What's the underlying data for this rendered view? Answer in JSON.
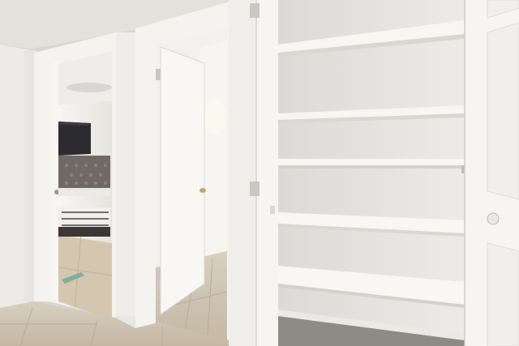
{
  "scene": {
    "kind": "real-estate interior photo",
    "visible_text": []
  },
  "palette": {
    "wall": "#ecebe8",
    "ceiling": "#e6e4e0",
    "trim": "#f4f3f0",
    "floor_tile": "#d6cbb8",
    "floor_dark": "#b7ac98",
    "shelf": "#f5f4f1",
    "shadow": "#c9c7c2",
    "headboard": "#6f6a66",
    "tv": "#2c2c30",
    "door_knob": "#c7a35b"
  },
  "items": [
    {
      "name": "left-wall"
    },
    {
      "name": "ceiling"
    },
    {
      "name": "bedroom-doorway"
    },
    {
      "name": "bed-headboard"
    },
    {
      "name": "television"
    },
    {
      "name": "light-switch"
    },
    {
      "name": "bathroom-doorway"
    },
    {
      "name": "bathroom-door"
    },
    {
      "name": "closet-door-bifold"
    },
    {
      "name": "closet-shelves"
    },
    {
      "name": "tile-floor"
    }
  ]
}
